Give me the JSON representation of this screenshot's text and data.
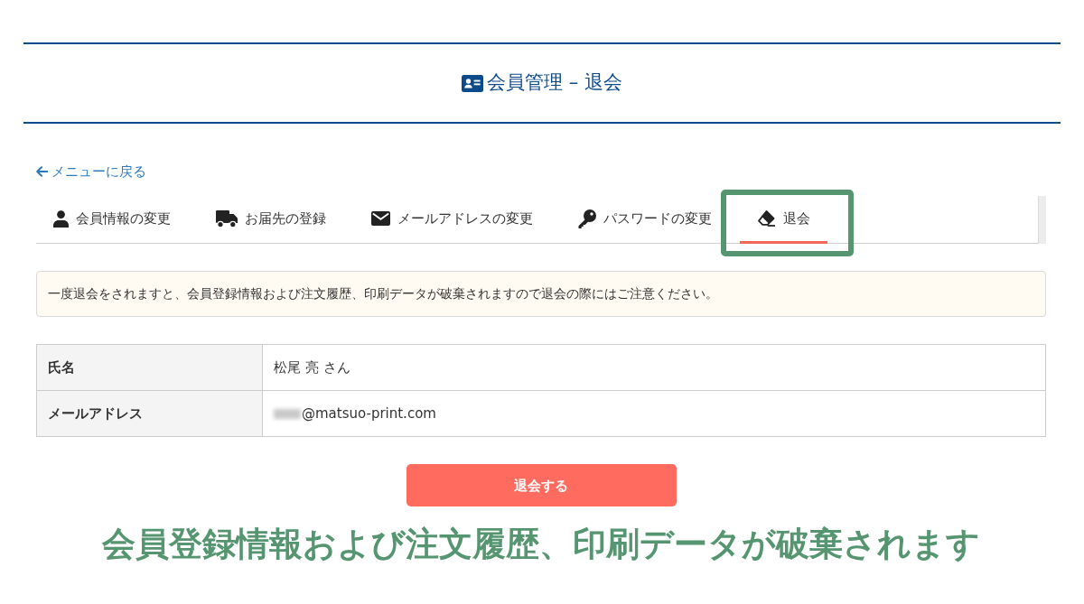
{
  "header": {
    "title": "会員管理 – 退会"
  },
  "back_link": {
    "label": "メニューに戻る"
  },
  "tabs": [
    {
      "label": "会員情報の変更",
      "selected": false,
      "highlighted": false
    },
    {
      "label": "お届先の登録",
      "selected": false,
      "highlighted": false
    },
    {
      "label": "メールアドレスの変更",
      "selected": false,
      "highlighted": false
    },
    {
      "label": "パスワードの変更",
      "selected": false,
      "highlighted": false
    },
    {
      "label": "退会",
      "selected": true,
      "highlighted": true
    }
  ],
  "notice": "一度退会をされますと、会員登録情報および注文履歴、印刷データが破棄されますので退会の際にはご注意ください。",
  "profile_table": {
    "rows": [
      {
        "label": "氏名",
        "value": "松尾 亮 さん",
        "blurred_prefix": false
      },
      {
        "label": "メールアドレス",
        "value": "@matsuo-print.com",
        "blurred_prefix": true
      }
    ]
  },
  "withdraw_button": {
    "label": "退会する"
  },
  "annotation": {
    "caption": "会員登録情報および注文履歴、印刷データが破棄されます"
  }
}
